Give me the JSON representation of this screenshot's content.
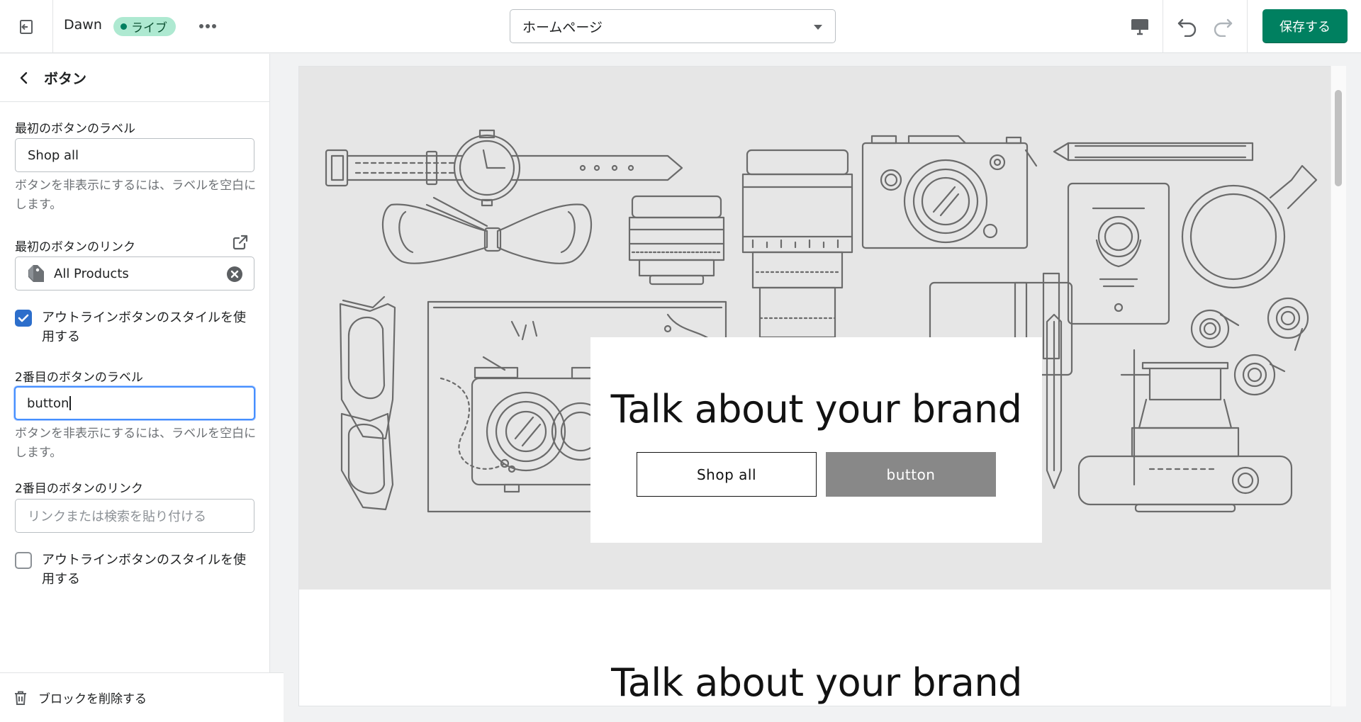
{
  "topbar": {
    "theme_name": "Dawn",
    "live_badge": "ライブ",
    "page_selector": "ホームページ",
    "save_label": "保存する"
  },
  "sidebar": {
    "title": "ボタン",
    "first_label_title": "最初のボタンのラベル",
    "first_label_value": "Shop all",
    "first_label_help": "ボタンを非表示にするには、ラベルを空白にします。",
    "first_link_title": "最初のボタンのリンク",
    "first_link_value": "All Products",
    "first_outline_label": "アウトラインボタンのスタイルを使用する",
    "first_outline_checked": true,
    "second_label_title": "2番目のボタンのラベル",
    "second_label_value": "button",
    "second_label_help": "ボタンを非表示にするには、ラベルを空白にします。",
    "second_link_title": "2番目のボタンのリンク",
    "second_link_placeholder": "リンクまたは検索を貼り付ける",
    "second_outline_label": "アウトラインボタンのスタイルを使用する",
    "second_outline_checked": false,
    "delete_label": "ブロックを削除する"
  },
  "preview": {
    "banner_heading": "Talk about your brand",
    "button_1": "Shop all",
    "button_2": "button",
    "section2_heading": "Talk about your brand"
  },
  "colors": {
    "accent": "#008060",
    "checkbox": "#2c6ecb",
    "focus": "#458fff",
    "solid_button": "#888888"
  }
}
